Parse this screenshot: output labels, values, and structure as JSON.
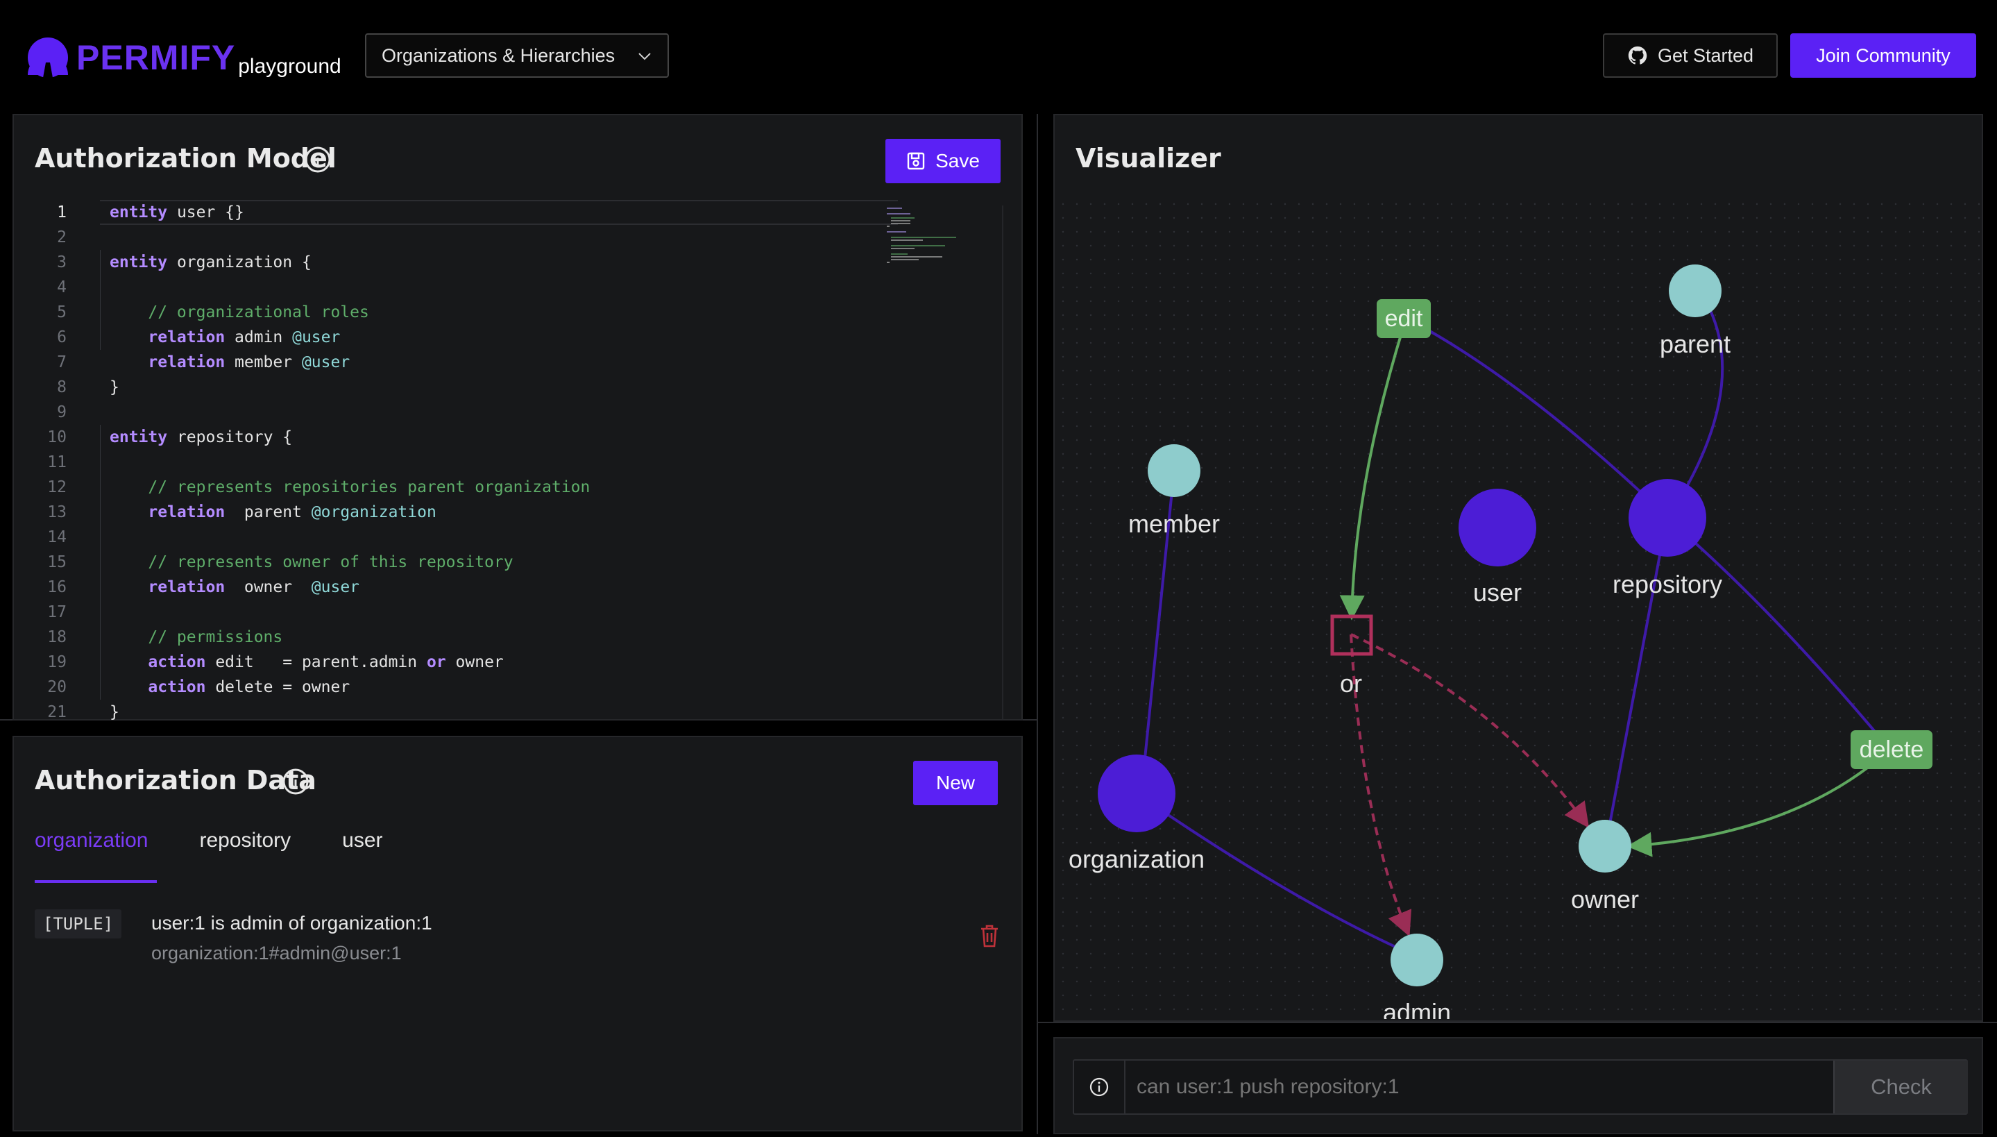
{
  "header": {
    "logo_text": "PERMIFY",
    "logo_sub": "playground",
    "example_select": "Organizations & Hierarchies",
    "get_started": "Get Started",
    "join_community": "Join Community"
  },
  "model_panel": {
    "title": "Authorization Model",
    "save_label": "Save",
    "lines": [
      {
        "n": "1"
      },
      {
        "n": "2"
      },
      {
        "n": "3"
      },
      {
        "n": "4"
      },
      {
        "n": "5"
      },
      {
        "n": "6"
      },
      {
        "n": "7"
      },
      {
        "n": "8"
      },
      {
        "n": "9"
      },
      {
        "n": "10"
      },
      {
        "n": "11"
      },
      {
        "n": "12"
      },
      {
        "n": "13"
      },
      {
        "n": "14"
      },
      {
        "n": "15"
      },
      {
        "n": "16"
      },
      {
        "n": "17"
      },
      {
        "n": "18"
      },
      {
        "n": "19"
      },
      {
        "n": "20"
      },
      {
        "n": "21"
      }
    ],
    "code": {
      "l1_kw": "entity",
      "l1_rest": " user {}",
      "l3_kw": "entity",
      "l3_rest": " organization {",
      "l5_cm": "// organizational roles",
      "l6_kw": "relation",
      "l6_rest": " admin ",
      "l6_ty": "@user",
      "l7_kw": "relation",
      "l7_rest": " member ",
      "l7_ty": "@user",
      "l8": "}",
      "l10_kw": "entity",
      "l10_rest": " repository {",
      "l12_cm": "// represents repositories parent organization",
      "l13_kw": "relation",
      "l13_rest": "  parent ",
      "l13_ty": "@organization",
      "l15_cm": "// represents owner of this repository",
      "l16_kw": "relation",
      "l16_rest": "  owner  ",
      "l16_ty": "@user",
      "l18_cm": "// permissions",
      "l19_kw": "action",
      "l19_rest": " edit   = parent.admin ",
      "l19_kw2": "or",
      "l19_rest2": " owner",
      "l20_kw": "action",
      "l20_rest": " delete = owner",
      "l21": "}"
    }
  },
  "data_panel": {
    "title": "Authorization Data",
    "new_label": "New",
    "tabs": [
      {
        "label": "organization"
      },
      {
        "label": "repository"
      },
      {
        "label": "user"
      }
    ],
    "tuple": {
      "tag": "[TUPLE]",
      "description": "user:1 is admin of organization:1",
      "raw": "organization:1#admin@user:1"
    }
  },
  "visualizer": {
    "title": "Visualizer",
    "nodes": {
      "edit": "edit",
      "parent": "parent",
      "member": "member",
      "user": "user",
      "repository": "repository",
      "or": "or",
      "delete": "delete",
      "organization": "organization",
      "owner": "owner",
      "admin": "admin"
    }
  },
  "check": {
    "placeholder": "can user:1 push repository:1",
    "button": "Check"
  },
  "colors": {
    "accent": "#5b21f5",
    "entity_node": "#4c1dd6",
    "relation_node": "#8ecccc",
    "action_node": "#5fa85f",
    "or_node": "#b0305c"
  }
}
